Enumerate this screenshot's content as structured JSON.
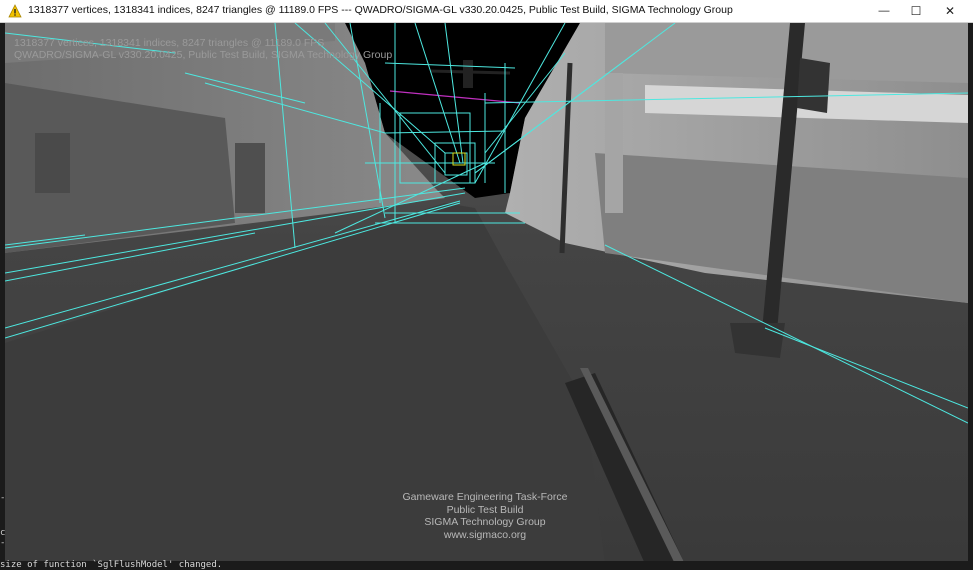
{
  "window": {
    "title": "1318377 vertices, 1318341 indices, 8247 triangles @ 11189.0 FPS --- QWADRO/SIGMA-GL v330.20.0425, Public Test Build, SIGMA Technology Group",
    "controls": {
      "minimize": "—",
      "maximize": "☐",
      "close": "✕"
    },
    "warning_icon": "warning-triangle-icon",
    "accent_warning": "#f2c200"
  },
  "overlay": {
    "stats": "1318377 vertices, 1318341 indices, 8247 triangles @ 11189.0 FPS",
    "renderer": "QWADRO/SIGMA-GL v330.20.0425, Public Test Build, SIGMA Technology Group"
  },
  "watermark": {
    "line1": "Gameware Engineering Task-Force",
    "line2": "Public Test Build",
    "line3": "SIGMA Technology Group",
    "line4": "www.sigmaco.org"
  },
  "console": {
    "text": "size of function `SglFlushModel' changed."
  },
  "edge_chars": {
    "c1": "c",
    "c2": "-",
    "c3": "-",
    "c4": "c"
  },
  "colors": {
    "wireframe": "#4de8e0",
    "magenta_line": "#c030c0"
  }
}
